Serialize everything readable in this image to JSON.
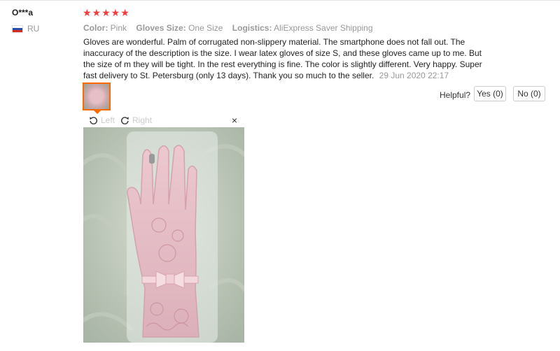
{
  "review": {
    "user": "O***a",
    "country": "RU",
    "rating_stars": "★★★★★",
    "rating": 5,
    "attributes": {
      "color_label": "Color:",
      "color_value": "Pink",
      "size_label": "Gloves Size:",
      "size_value": "One Size",
      "logistics_label": "Logistics:",
      "logistics_value": "AliExpress Saver Shipping"
    },
    "text": "Gloves are wonderful. Palm of corrugated non-slippery material. The smartphone does not fall out. The inaccuracy of the description is the size. I wear latex gloves of size S, and these gloves came up to me. But the size of m they will be tight. In the rest everything is fine. The color is slightly different. Very happy. Super fast delivery to St. Petersburg (only 13 days). Thank you so much to the seller.",
    "date": "29 Jun 2020 22:17"
  },
  "helpful": {
    "label": "Helpful?",
    "yes": "Yes (0)",
    "no": "No (0)"
  },
  "viewer": {
    "rotate_left": "Left",
    "rotate_right": "Right",
    "close": "×"
  },
  "colors": {
    "star": "#f53c3c",
    "accent": "#ff6a00",
    "muted": "#999999"
  }
}
